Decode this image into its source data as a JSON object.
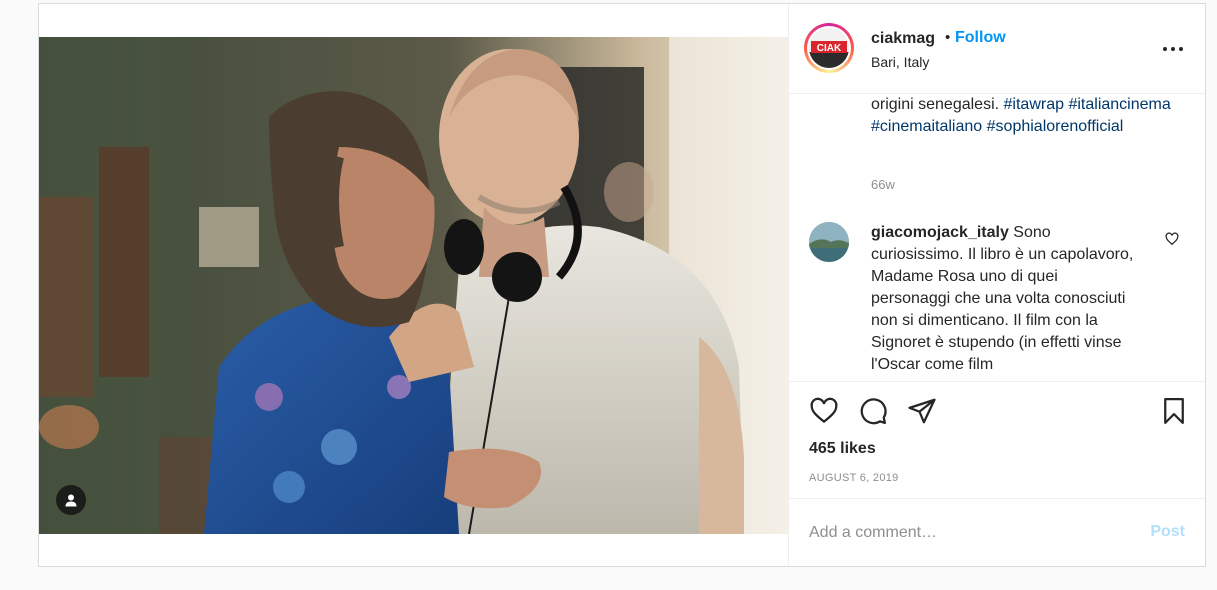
{
  "header": {
    "username": "ciakmag",
    "dot": "•",
    "follow_label": "Follow",
    "location": "Bari, Italy",
    "avatar_text": "CIAK",
    "more_icon": "more-horizontal-icon"
  },
  "caption": {
    "text": "origini senegalesi.",
    "hashtags": [
      "#itawrap",
      "#italiancinema",
      "#cinemaitaliano",
      "#sophialorenofficial"
    ],
    "time": "66w"
  },
  "comment": {
    "username": "giacomojack_italy",
    "text": "Sono curiosissimo. Il libro è un capolavoro, Madame Rosa uno di quei personaggi che una volta conosciuti non si dimenticano. Il film con la Signoret è stupendo (in effetti vinse l'Oscar come film"
  },
  "actions": {
    "icons": [
      "heart-icon",
      "comment-icon",
      "share-icon",
      "bookmark-icon"
    ],
    "likes": "465 likes",
    "date": "AUGUST 6, 2019"
  },
  "add_comment": {
    "placeholder": "Add a comment…",
    "post_label": "Post"
  },
  "colors": {
    "link": "#0095f6",
    "hashtag": "#00376b",
    "muted": "#8e8e8e",
    "post_disabled": "#b2dffc"
  }
}
